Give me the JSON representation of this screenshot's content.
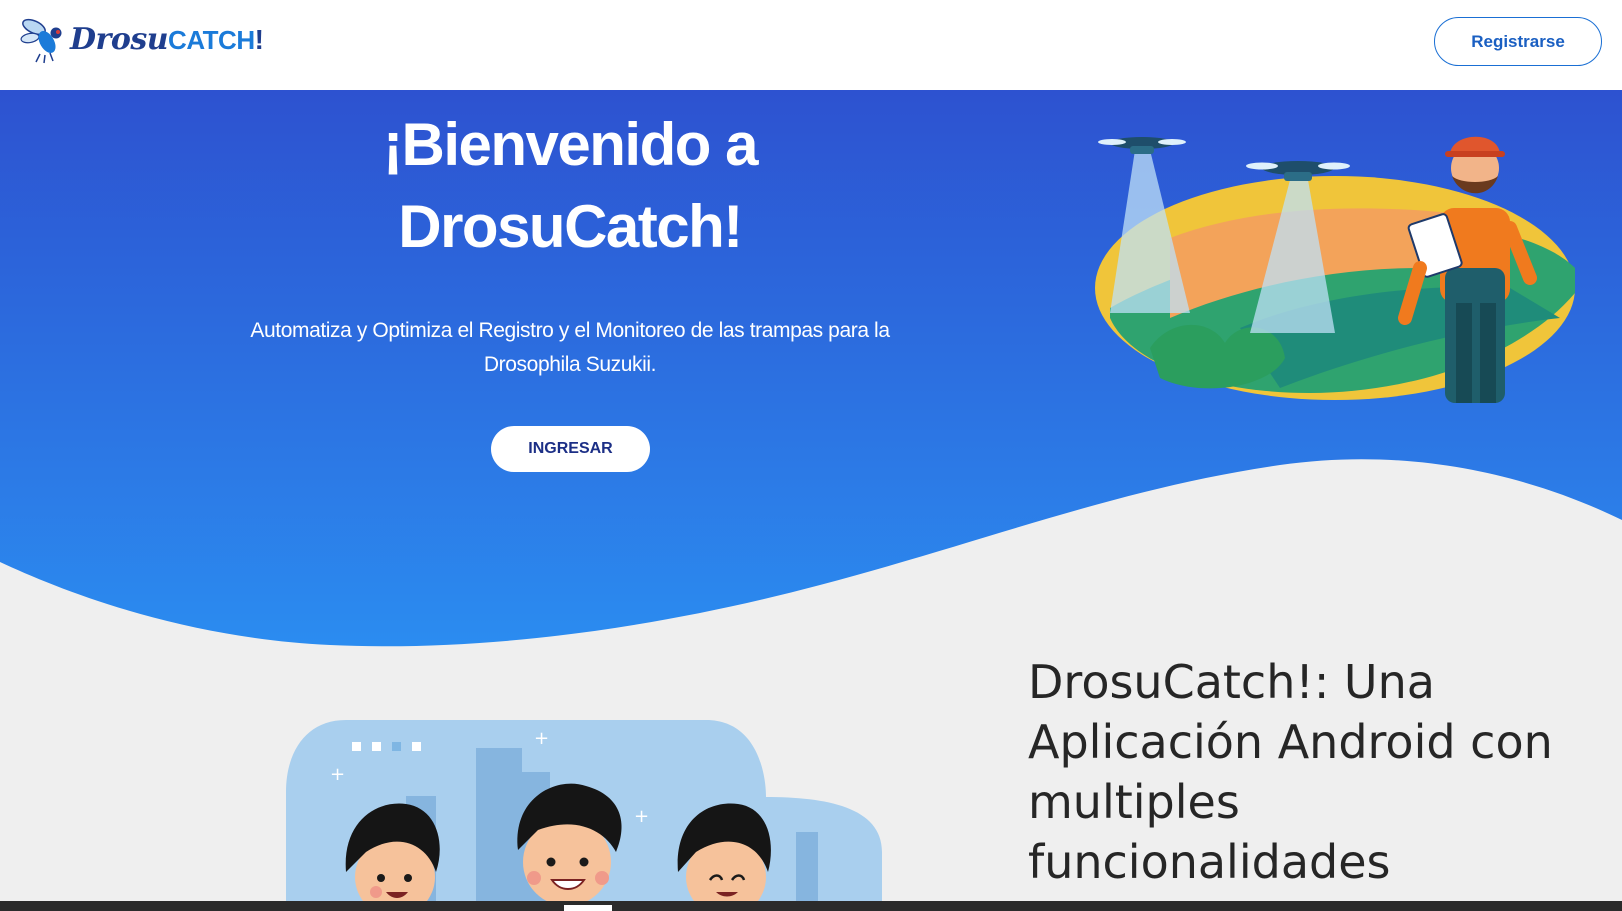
{
  "header": {
    "logo_prefix": "Drosu",
    "logo_catch": "CATCH",
    "logo_bang": "!",
    "register_label": "Registrarse"
  },
  "hero": {
    "title_line1": "¡Bienvenido a",
    "title_line2": "DrosuCatch!",
    "subtitle_line1": "Automatiza y Optimiza el Registro y el Monitoreo de las trampas para la",
    "subtitle_line2": "Drosophila Suzukii.",
    "cta_label": "INGRESAR"
  },
  "section2": {
    "title_line1": "DrosuCatch!: Una",
    "title_line2": "Aplicación Android con",
    "title_line3": "multiples",
    "title_line4": "funcionalidades"
  },
  "icons": {
    "logo": "fly-icon",
    "hero_illustration": "farmer-drones-illustration",
    "section_illustration": "people-illustration"
  },
  "colors": {
    "hero_top": "#2d52d0",
    "hero_bottom": "#2b8cf0",
    "background": "#efefef",
    "accent": "#1a6fd4",
    "cta_text": "#1c2f86"
  }
}
